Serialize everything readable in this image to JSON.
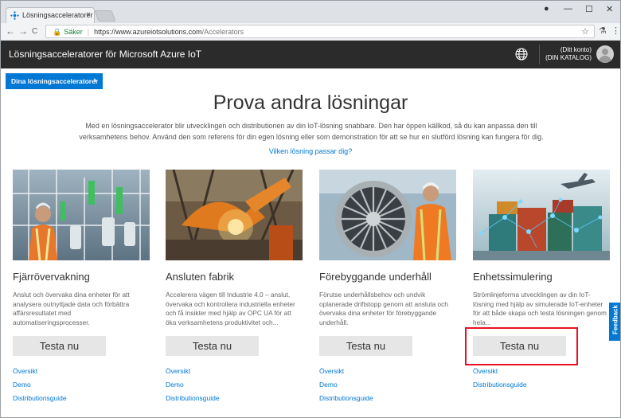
{
  "browser": {
    "tab_title": "Lösningsacceleratorer Az",
    "tab_close": "×",
    "security_label": "Säker",
    "url_host": "https://www.azureiotsolutions.com",
    "url_path": "/Accelerators",
    "nav": {
      "back": "←",
      "forward": "→",
      "reload": "C"
    },
    "window_controls": {
      "account": "●",
      "minimize": "—",
      "maximize": "☐",
      "close": "✕"
    }
  },
  "header": {
    "title": "Lösningsacceleratorer för Microsoft Azure IoT",
    "account_name": "(Ditt konto)",
    "account_catalog": "(DIN KATALOG)"
  },
  "main": {
    "solutions_button": "Dina lösningsacceleratorer",
    "page_title": "Prova andra lösningar",
    "lead": "Med en lösningsaccelerator blir utvecklingen och distributionen av din IoT-lösning snabbare. Den har öppen källkod, så du kan anpassa den till verksamhetens behov. Använd den som referens för din egen lösning eller som demonstration för att se hur en slutförd lösning kan fungera för dig.",
    "which_link": "Vilken lösning passar dig?"
  },
  "cards": [
    {
      "title": "Fjärrövervakning",
      "description": "Anslut och övervaka dina enheter för att analysera outnyttjade data och förbättra affärsresultatet med automatiseringsprocesser.",
      "button": "Testa nu",
      "links": [
        "Översikt",
        "Demo",
        "Distributionsguide"
      ]
    },
    {
      "title": "Ansluten fabrik",
      "description": "Accelerera vägen till Industrie 4.0 – anslut, övervaka och kontrollera industriella enheter och få insikter med hjälp av OPC UA för att öka verksamhetens produktivitet och...",
      "button": "Testa nu",
      "links": [
        "Översikt",
        "Demo",
        "Distributionsguide"
      ]
    },
    {
      "title": "Förebyggande underhåll",
      "description": "Förutse underhållsbehov och undvik oplanerade driftstopp genom att ansluta och övervaka dina enheter för förebyggande underhåll.",
      "button": "Testa nu",
      "links": [
        "Översikt",
        "Demo",
        "Distributionsguide"
      ]
    },
    {
      "title": "Enhetssimulering",
      "description": "Strömlinjeforma utvecklingen av din IoT-lösning med hjälp av simulerade IoT-enheter för att både skapa och testa lösningen genom hela...",
      "button": "Testa nu",
      "links": [
        "Översikt",
        "Distributionsguide"
      ]
    }
  ],
  "feedback_label": "Feedback",
  "colors": {
    "accent": "#0078d4",
    "header_bg": "#2b2b2b",
    "highlight": "#e81123"
  }
}
